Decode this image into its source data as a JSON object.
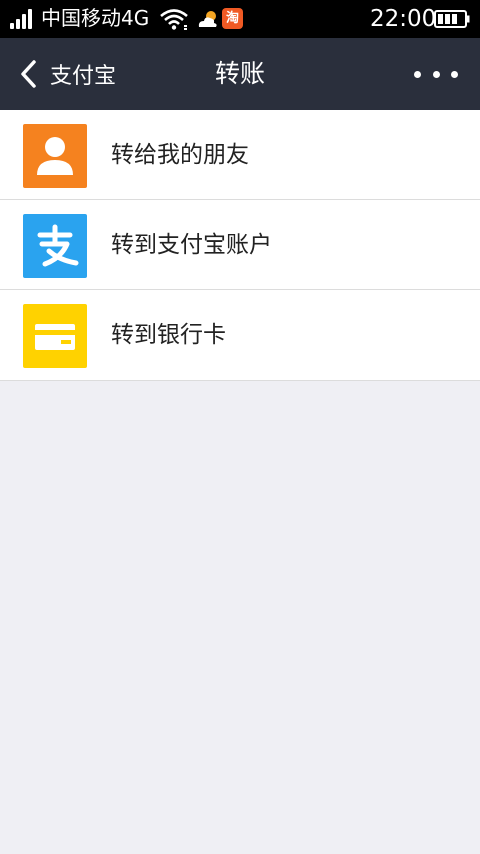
{
  "status_bar": {
    "carrier": "中国移动4G",
    "taobao_badge": "淘",
    "time": "22:00",
    "icons": [
      "signal-icon",
      "wifi-icon",
      "weather-icon",
      "taobao-notification-icon",
      "battery-icon"
    ]
  },
  "nav": {
    "back_label": "支付宝",
    "title": "转账",
    "more_icon": "more-dots-icon"
  },
  "transfer_options": [
    {
      "label": "转给我的朋友",
      "icon": "friend-person-icon",
      "color": "#f5821f"
    },
    {
      "label": "转到支付宝账户",
      "icon": "alipay-icon",
      "color": "#2aa3ef"
    },
    {
      "label": "转到银行卡",
      "icon": "bank-card-icon",
      "color": "#ffd200"
    }
  ],
  "colors": {
    "status_bar": "#000000",
    "nav_bar": "#2a2f3c",
    "page_background": "#efeff4"
  }
}
